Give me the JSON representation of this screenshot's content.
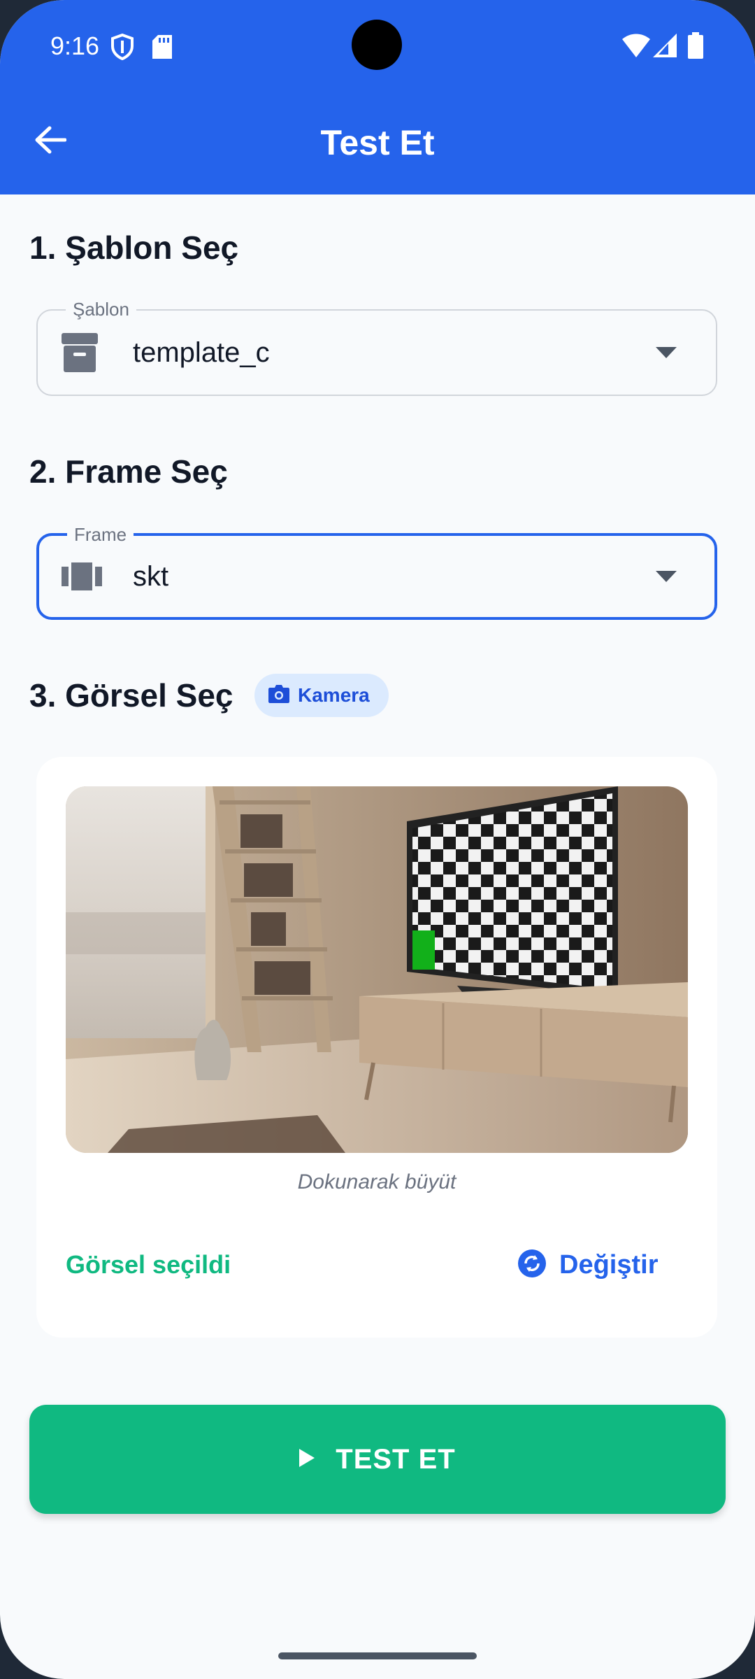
{
  "status_bar": {
    "time": "9:16",
    "icons": [
      "shield-icon",
      "sd-card-icon",
      "wifi-icon",
      "signal-icon",
      "battery-icon"
    ]
  },
  "app_bar": {
    "title": "Test Et",
    "back_icon": "arrow-back-icon",
    "color": "#2563eb"
  },
  "template_section": {
    "title": "1. Şablon Seç",
    "field_label": "Şablon",
    "value": "template_c",
    "icon": "archive-box-icon"
  },
  "frame_section": {
    "title": "2. Frame Seç",
    "field_label": "Frame",
    "value": "skt",
    "icon": "view-carousel-icon"
  },
  "image_section": {
    "title": "3. Görsel Seç",
    "chip_label": "Kamera",
    "chip_icon": "camera-icon",
    "hint": "Dokunarak büyüt",
    "status": "Görsel seçildi",
    "change_label": "Değiştir",
    "change_icon": "sync-icon"
  },
  "action": {
    "label": "TEST ET",
    "icon": "play-icon",
    "color": "#10b981"
  }
}
